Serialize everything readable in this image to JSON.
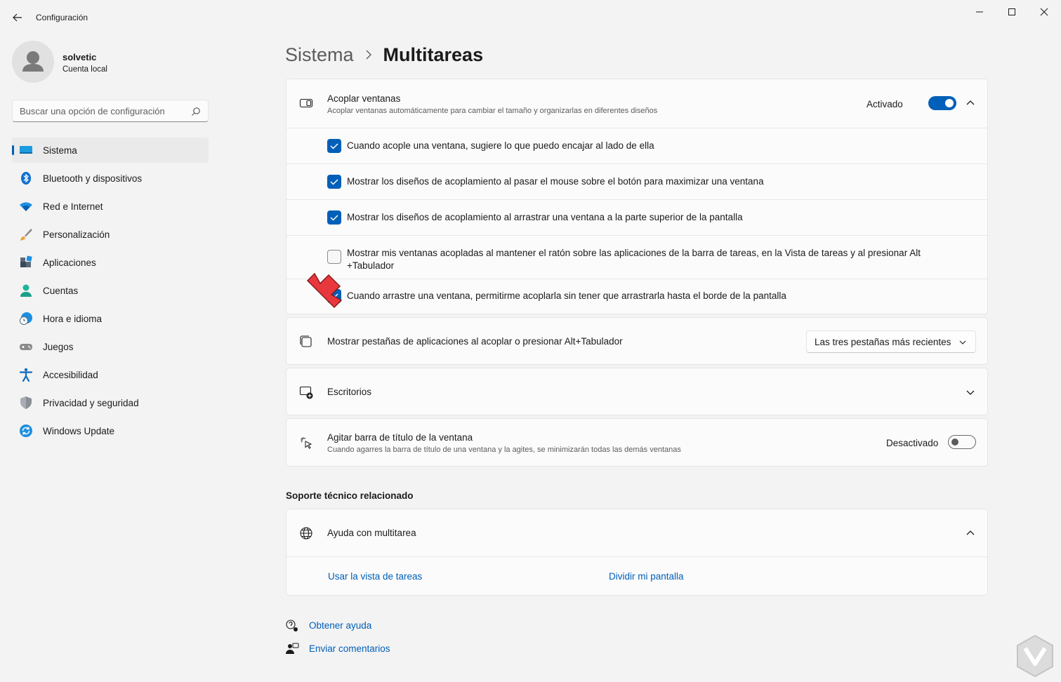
{
  "window": {
    "title": "Configuración",
    "controls": [
      "minimize",
      "maximize",
      "close"
    ]
  },
  "profile": {
    "name": "solvetic",
    "account_type": "Cuenta local"
  },
  "search": {
    "placeholder": "Buscar una opción de configuración",
    "icon": "search-icon"
  },
  "sidebar": {
    "items": [
      {
        "label": "Sistema",
        "icon": "system-icon",
        "active": true
      },
      {
        "label": "Bluetooth y dispositivos",
        "icon": "bluetooth-icon",
        "active": false
      },
      {
        "label": "Red e Internet",
        "icon": "wifi-icon",
        "active": false
      },
      {
        "label": "Personalización",
        "icon": "brush-icon",
        "active": false
      },
      {
        "label": "Aplicaciones",
        "icon": "apps-icon",
        "active": false
      },
      {
        "label": "Cuentas",
        "icon": "account-icon",
        "active": false
      },
      {
        "label": "Hora e idioma",
        "icon": "time-language-icon",
        "active": false
      },
      {
        "label": "Juegos",
        "icon": "gamepad-icon",
        "active": false
      },
      {
        "label": "Accesibilidad",
        "icon": "accessibility-icon",
        "active": false
      },
      {
        "label": "Privacidad y seguridad",
        "icon": "shield-icon",
        "active": false
      },
      {
        "label": "Windows Update",
        "icon": "update-icon",
        "active": false
      }
    ]
  },
  "breadcrumb": {
    "parent": "Sistema",
    "current": "Multitareas"
  },
  "snap": {
    "title": "Acoplar ventanas",
    "subtitle": "Acoplar ventanas automáticamente para cambiar el tamaño y organizarlas en diferentes diseños",
    "status": "Activado",
    "enabled": true,
    "expanded": true,
    "options": [
      {
        "label": "Cuando acople una ventana, sugiere lo que puedo encajar al lado de ella",
        "checked": true
      },
      {
        "label": "Mostrar los diseños de acoplamiento al pasar el mouse sobre el botón para maximizar una ventana",
        "checked": true
      },
      {
        "label": "Mostrar los diseños de acoplamiento al arrastrar una ventana a la parte superior de la pantalla",
        "checked": true
      },
      {
        "label": "Mostrar mis ventanas acopladas al mantener el ratón sobre las aplicaciones de la barra de tareas, en la Vista de tareas y al presionar Alt +Tabulador",
        "checked": false
      },
      {
        "label": "Cuando arrastre una ventana, permitirme acoplarla sin tener que arrastrarla hasta el borde de la pantalla",
        "checked": true
      }
    ]
  },
  "alt_tab": {
    "title": "Mostrar pestañas de aplicaciones al acoplar o presionar Alt+Tabulador",
    "selected": "Las tres pestañas más recientes"
  },
  "desktops": {
    "title": "Escritorios"
  },
  "shake": {
    "title": "Agitar barra de título de la ventana",
    "subtitle": "Cuando agarres la barra de título de una ventana y la agites, se minimizarán todas las demás ventanas",
    "status": "Desactivado",
    "enabled": false
  },
  "support": {
    "heading": "Soporte técnico relacionado",
    "help_title": "Ayuda con multitarea",
    "links": [
      "Usar la vista de tareas",
      "Dividir mi pantalla"
    ]
  },
  "footer": {
    "get_help": "Obtener ayuda",
    "feedback": "Enviar comentarios"
  },
  "colors": {
    "accent": "#005fb8",
    "annotation_arrow": "#e8383d"
  }
}
